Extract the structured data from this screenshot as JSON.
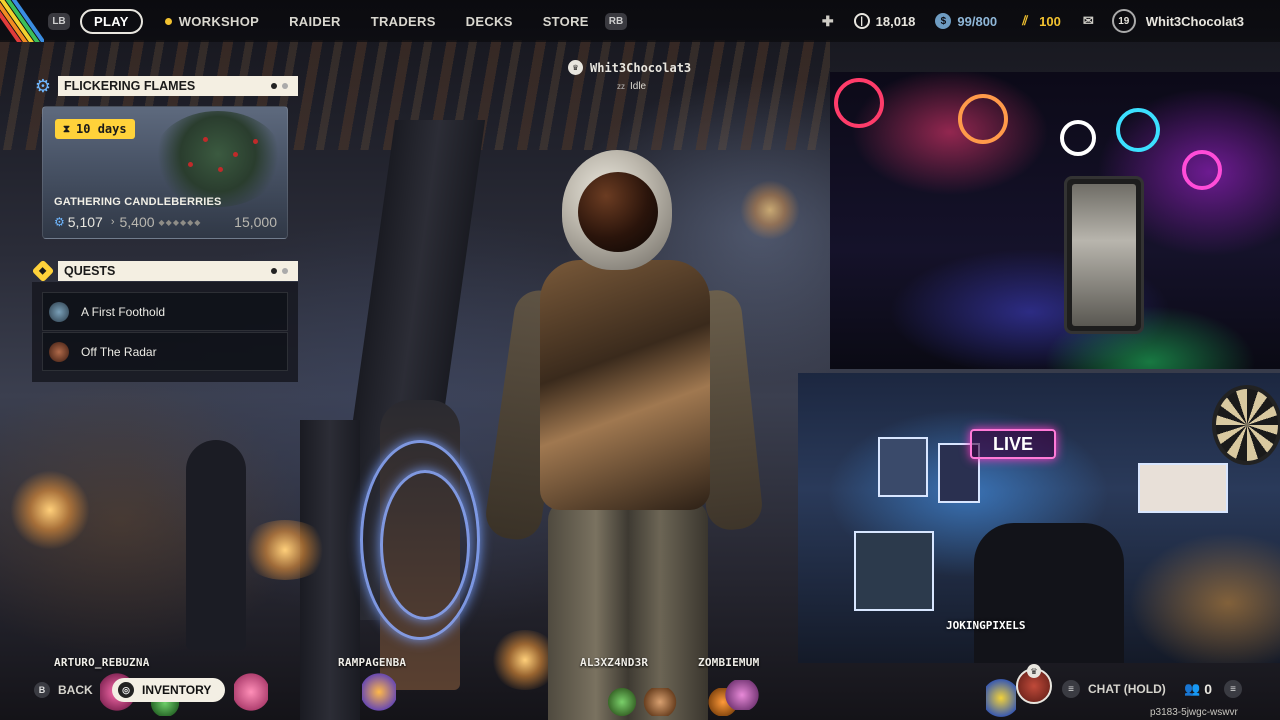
{
  "colors": {
    "accent_yellow": "#ffd23a",
    "panel_header": "#f4efe2",
    "blue_gear": "#6fb7ff"
  },
  "nav": {
    "lb": "LB",
    "rb": "RB",
    "play": "PLAY",
    "workshop": "WORKSHOP",
    "raider": "RAIDER",
    "traders": "TRADERS",
    "decks": "DECKS",
    "store": "STORE"
  },
  "currency": {
    "coins": "18,018",
    "stash": "99/800",
    "tokens": "100"
  },
  "user": {
    "level": "19",
    "name": "Whit3Chocolat3"
  },
  "event": {
    "title": "FLICKERING FLAMES",
    "timer": "10 days",
    "name": "GATHERING CANDLEBERRIES",
    "current": "5,107",
    "next": "5,400",
    "max": "15,000"
  },
  "quests": {
    "title": "QUESTS",
    "items": [
      "A First Foothold",
      "Off The Radar"
    ]
  },
  "player": {
    "name": "Whit3Chocolat3",
    "status": "Idle"
  },
  "webcam": {
    "caption": "JOKINGPIXELS",
    "sign": "LIVE"
  },
  "squad": [
    "ARTURO_REBUZNA",
    "RAMPAGENBA",
    "AL3XZ4ND3R",
    "ZOMBIEMUM"
  ],
  "bottom": {
    "back_key": "B",
    "back": "BACK",
    "inventory": "INVENTORY",
    "chat": "CHAT (HOLD)",
    "party_count": "0",
    "room_code": "p3183-5jwgc-wswvr"
  },
  "icons": [
    "gear-icon",
    "quest-icon",
    "crown-icon",
    "people-icon",
    "menu-icon",
    "mail-icon",
    "coin-icon",
    "hourglass-icon"
  ]
}
